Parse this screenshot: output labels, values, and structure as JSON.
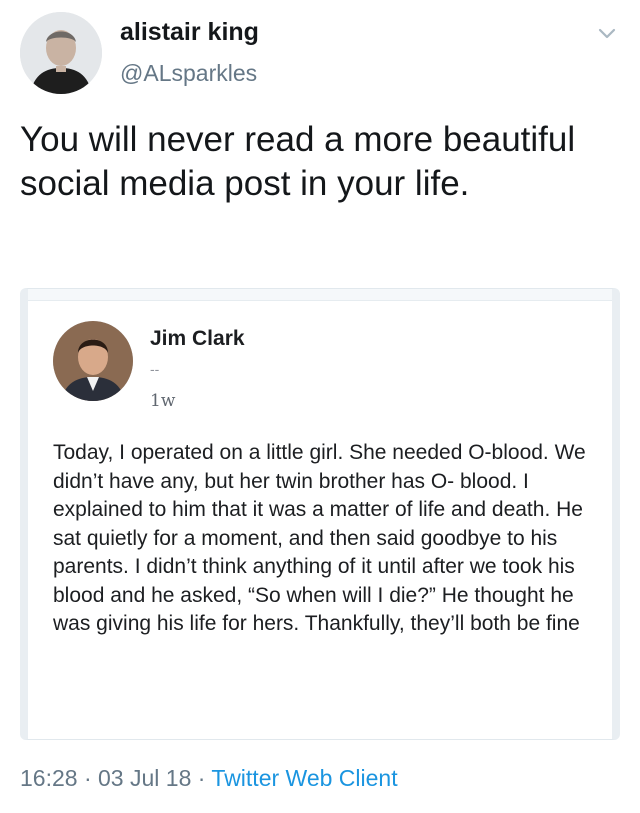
{
  "author": {
    "name": "alistair king",
    "handle": "@ALsparkles"
  },
  "tweet": {
    "text": "You will never read a more beautiful social media post in your life."
  },
  "embedded_post": {
    "author": "Jim Clark",
    "subtitle": "--",
    "time": "1w",
    "body": "Today, I operated on a little girl. She needed O-blood. We didn’t have any, but her twin brother has O- blood. I explained to him that it was a matter of life and death. He sat quietly for a moment, and then said goodbye to his parents. I didn’t think anything of it until after we took his blood and he asked, “So when will I die?” He thought he was giving his life for hers. Thankfully, they’ll both be fine"
  },
  "meta": {
    "time": "16:28",
    "separator": "·",
    "date": "03 Jul 18",
    "client": "Twitter Web Client"
  },
  "icons": {
    "caret": "chevron-down-icon"
  },
  "colors": {
    "secondary_text": "#657786",
    "link": "#1b95e0"
  }
}
